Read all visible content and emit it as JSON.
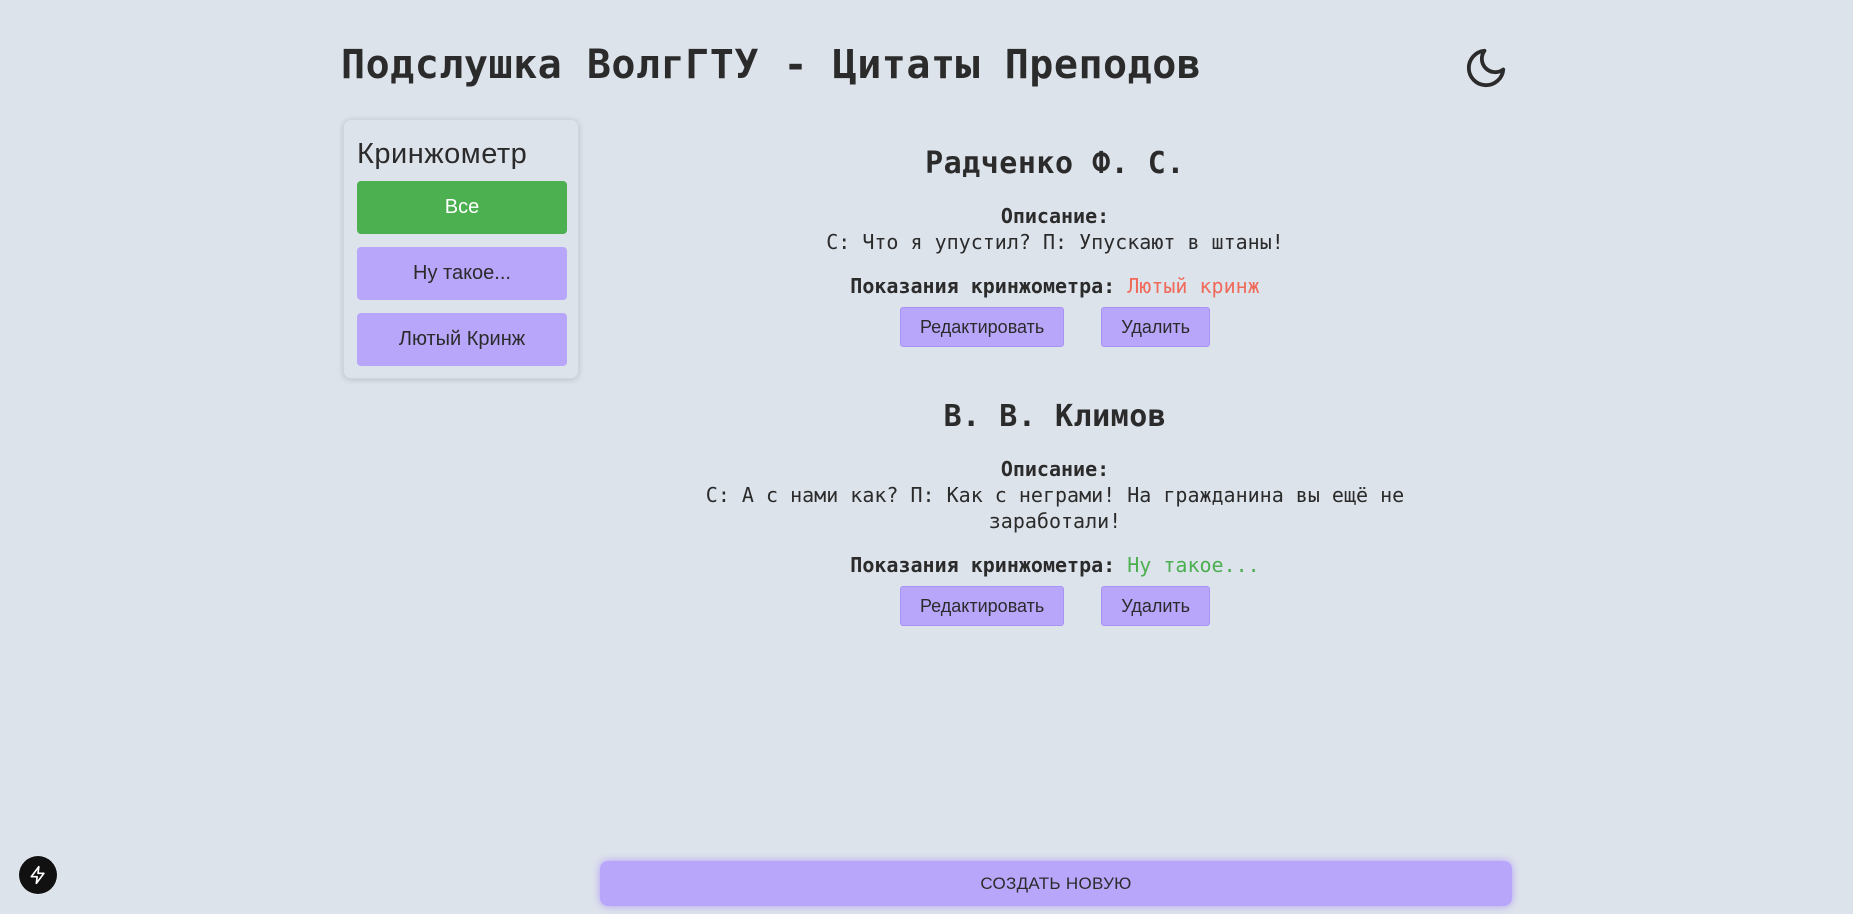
{
  "header": {
    "title": "Подслушка ВолгГТУ - Цитаты Преподов",
    "theme_icon": "moon-icon"
  },
  "filter": {
    "title": "Кринжометр",
    "options": [
      {
        "label": "Все",
        "active": true
      },
      {
        "label": "Ну такое...",
        "active": false
      },
      {
        "label": "Лютый Кринж",
        "active": false
      }
    ]
  },
  "quotes": [
    {
      "author": "Радченко Ф. С.",
      "description_label": "Описание:",
      "description": "С: Что я упустил? П: Упускают в штаны!",
      "cringe_label": "Показания кринжометра:",
      "cringe_value": "Лютый кринж",
      "cringe_color": "#f06a5a",
      "edit_label": "Редактировать",
      "delete_label": "Удалить"
    },
    {
      "author": "В. В. Климов",
      "description_label": "Описание:",
      "description": "С: А с нами как? П: Как с неграми! На гражданина вы ещё не заработали!",
      "cringe_label": "Показания кринжометра:",
      "cringe_value": "Ну такое...",
      "cringe_color": "#4caf50",
      "edit_label": "Редактировать",
      "delete_label": "Удалить"
    }
  ],
  "footer": {
    "create_label": "СОЗДАТЬ НОВУЮ",
    "dev_badge_icon": "lightning-icon"
  },
  "colors": {
    "background": "#dde3eb",
    "accent": "#b8a6fb",
    "active": "#4caf50",
    "badge": "#111111"
  }
}
